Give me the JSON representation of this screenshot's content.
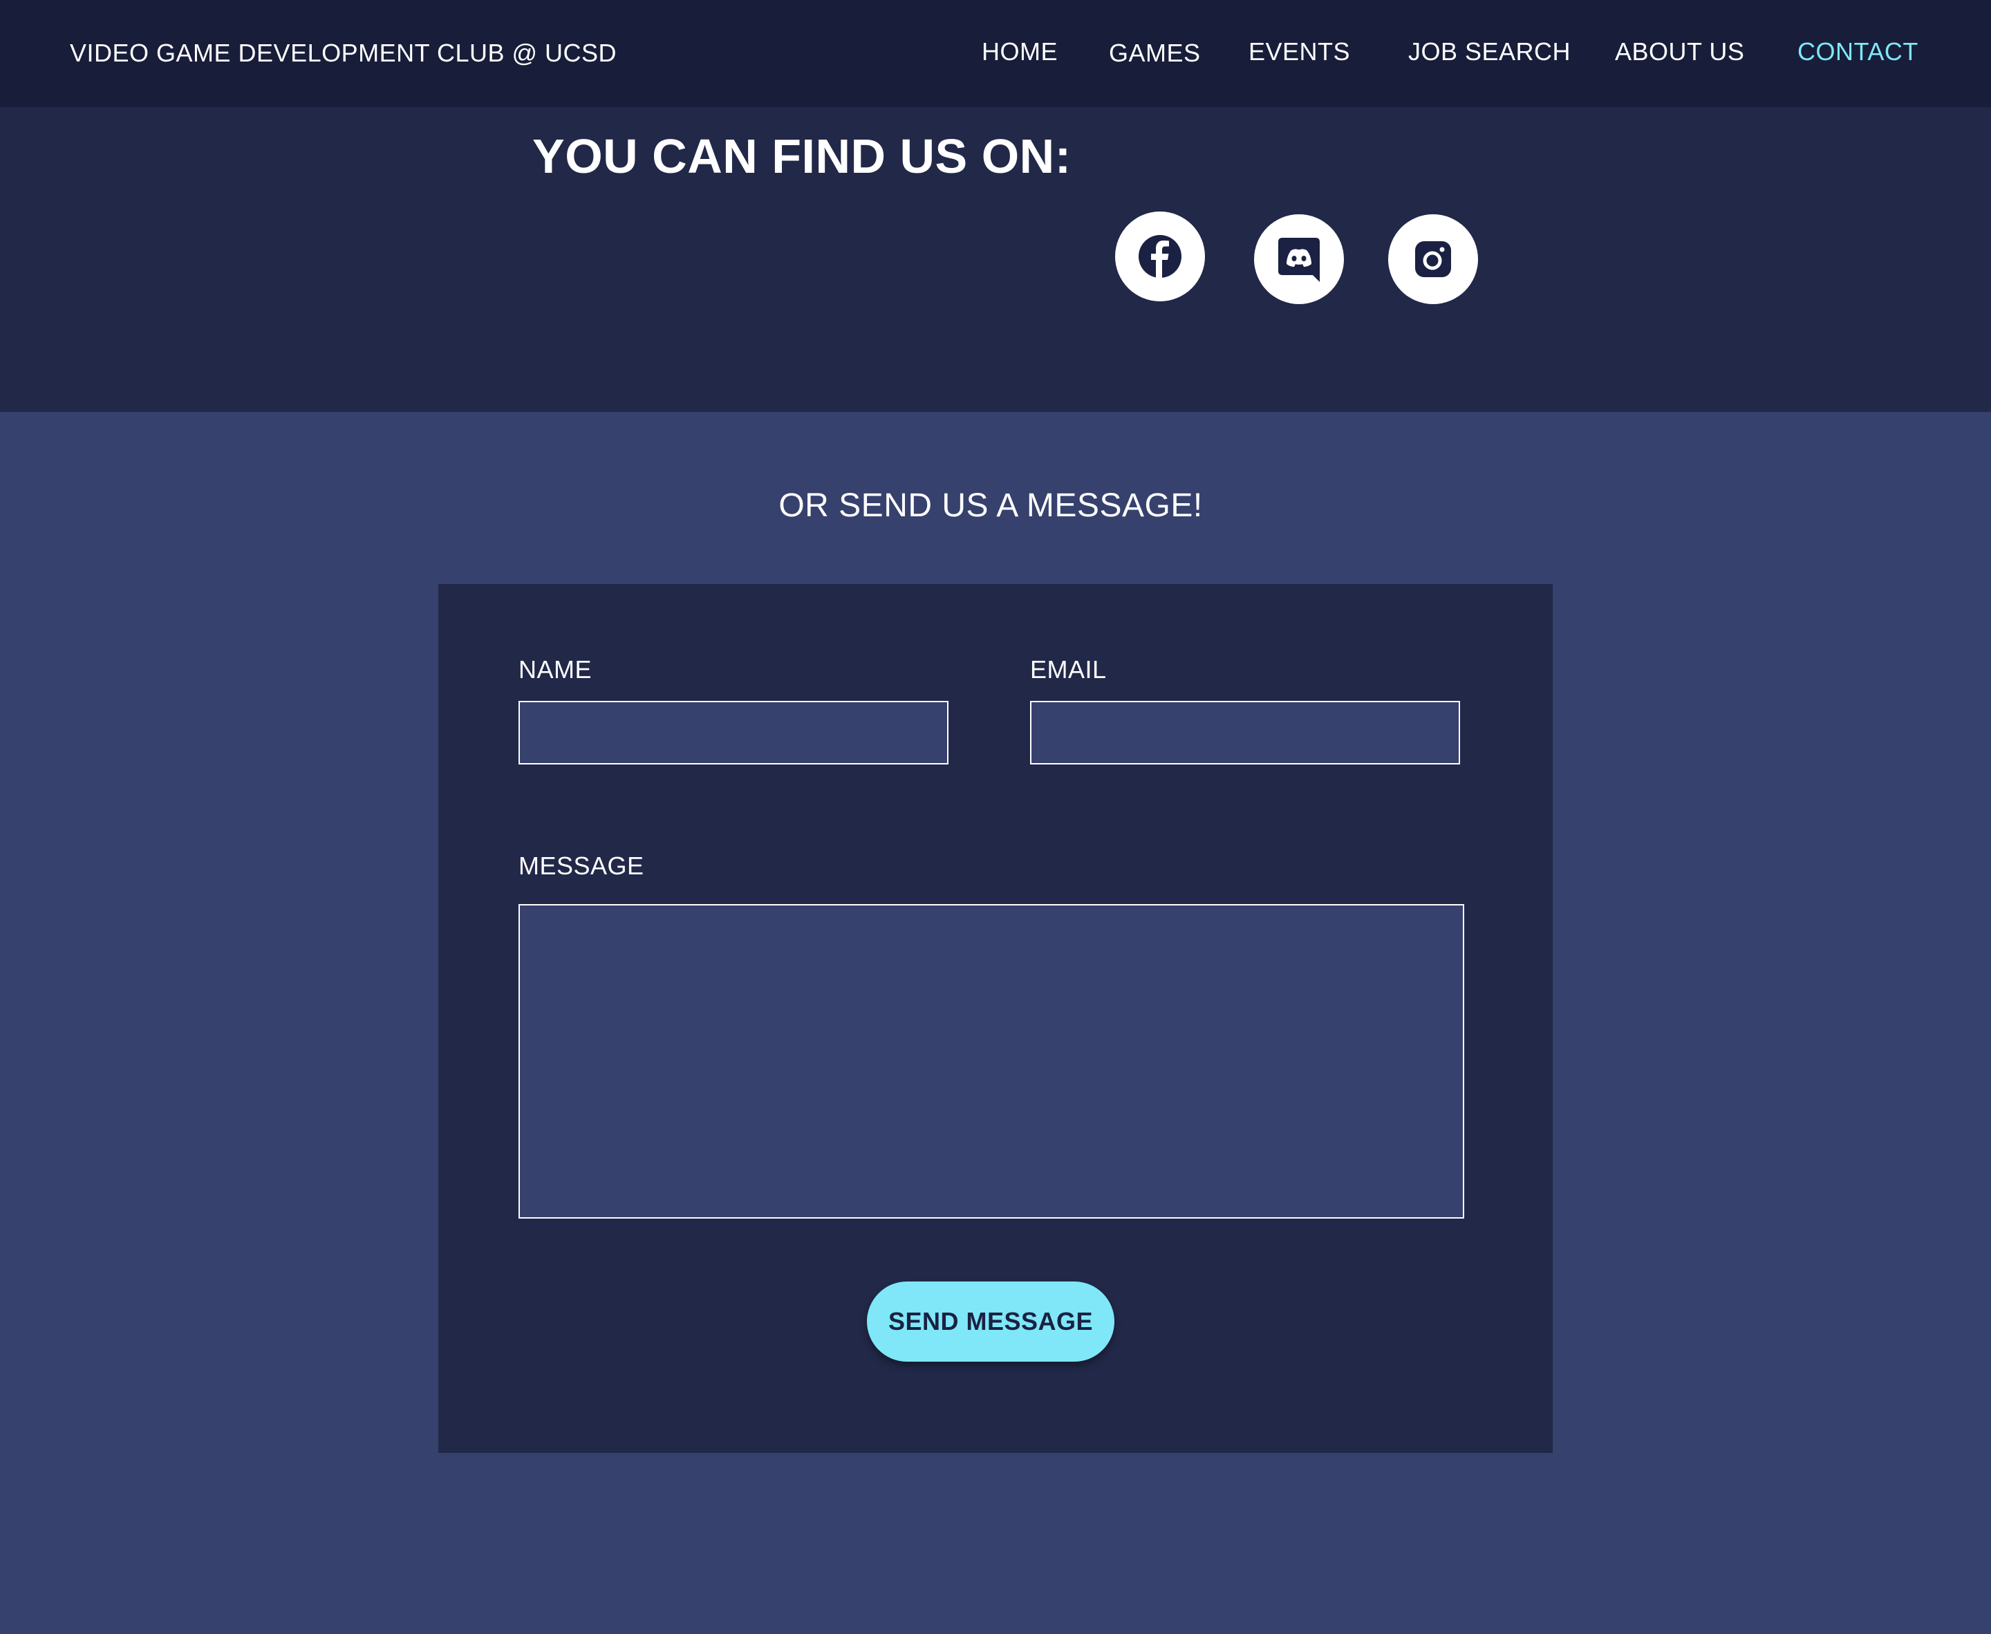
{
  "header": {
    "site_title": "VIDEO GAME DEVELOPMENT CLUB @ UCSD",
    "nav": {
      "home": "HOME",
      "games": "GAMES",
      "events": "EVENTS",
      "job_search": "JOB SEARCH",
      "about_us": "ABOUT US",
      "contact": "CONTACT"
    },
    "active_nav": "CONTACT"
  },
  "social": {
    "heading": "YOU CAN FIND US ON:",
    "icons": [
      "facebook-icon",
      "discord-icon",
      "instagram-icon"
    ]
  },
  "contact_form": {
    "heading": "OR SEND US A MESSAGE!",
    "name_label": "NAME",
    "name_value": "",
    "email_label": "EMAIL",
    "email_value": "",
    "message_label": "MESSAGE",
    "message_value": "",
    "submit_label": "SEND MESSAGE"
  },
  "colors": {
    "nav_background": "#181d39",
    "band_background": "#212848",
    "page_background": "#36416d",
    "accent": "#7fe7f7",
    "text": "#ffffff"
  }
}
